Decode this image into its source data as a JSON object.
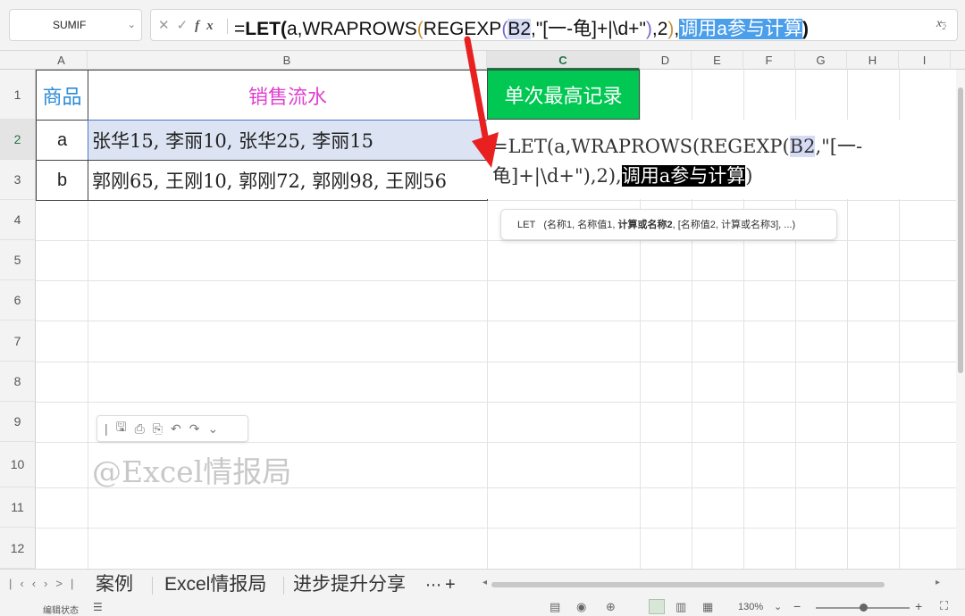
{
  "formula_bar": {
    "name_box": "SUMIF",
    "formula": {
      "eq": "=",
      "let": "LET",
      "p1": "(",
      "a_comma": "a,WRAPROWS",
      "p2": "(",
      "regexp": "REGEXP",
      "p3": "(",
      "b2": "B2",
      "mid": ",\"[一-龟]+|\\d+\"",
      "p3c": ")",
      "two": ",2",
      "p2c": ")",
      "comma": ",",
      "selected": "调用a参与计算",
      "p1c": ")"
    }
  },
  "columns": [
    "A",
    "B",
    "C",
    "D",
    "E",
    "F",
    "G",
    "H",
    "I"
  ],
  "rows": [
    "1",
    "2",
    "3",
    "4",
    "5",
    "6",
    "7",
    "8",
    "9",
    "10",
    "11",
    "12"
  ],
  "cells": {
    "A1": "商品",
    "B1": "销售流水",
    "C1": "单次最高记录",
    "A2": "a",
    "B2": "张华15, 李丽10, 张华25, 李丽15",
    "A3": "b",
    "B3": "郭刚65, 王刚10, 郭刚72, 郭刚98, 王刚56"
  },
  "editor": {
    "line1a": "=LET(a,WRAPROWS(REGEXP(",
    "b2": "B2",
    "line1b": ",\"[一-",
    "line2a": "龟]+|\\d+\"),2),",
    "selected": "调用a参与计算",
    "line2b": ")"
  },
  "tooltip": {
    "fn": "LET",
    "args_a": "(名称1, 名称值1, ",
    "args_bold": "计算或名称2",
    "args_b": ", [名称值2, 计算或名称3], ...)"
  },
  "watermark": "@Excel情报局",
  "sheet_tabs": [
    "案例",
    "Excel情报局",
    "进步提升分享"
  ],
  "status": {
    "mode": "编辑状态",
    "zoom": "130%"
  },
  "colors": {
    "header_a1": "#2a8bd6",
    "header_b1": "#e03fcf",
    "header_c1_bg": "#00c853",
    "row2_fill": "#dce4f3",
    "arrow": "#e82020"
  }
}
